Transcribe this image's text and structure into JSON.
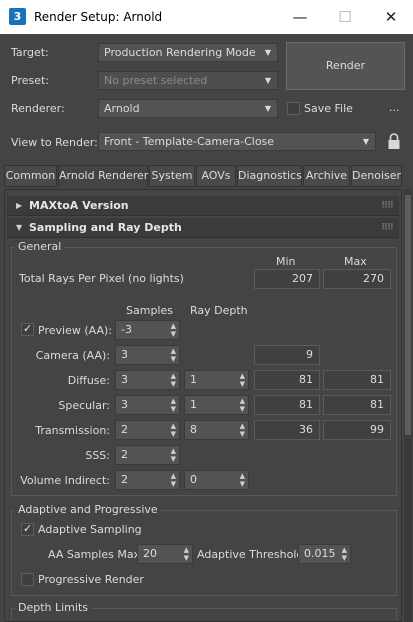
{
  "window": {
    "app_icon_text": "3",
    "title": "Render Setup: Arnold",
    "minimize": "—",
    "maximize": "☐",
    "close": "✕"
  },
  "target": {
    "label": "Target:",
    "value": "Production Rendering Mode"
  },
  "preset": {
    "label": "Preset:",
    "value": "No preset selected"
  },
  "renderer": {
    "label": "Renderer:",
    "value": "Arnold"
  },
  "save_file": {
    "label": "Save File",
    "checked": false
  },
  "more_button": "...",
  "view_to_render": {
    "label": "View to Render:",
    "value": "Front - Template-Camera-Close"
  },
  "lock_icon": "lock-icon",
  "render_button": "Render",
  "tabs": [
    "Common",
    "Arnold Renderer",
    "System",
    "AOVs",
    "Diagnostics",
    "Archive",
    "Denoiser"
  ],
  "active_tab": "Arnold Renderer",
  "rollouts": {
    "maxtoa": {
      "title": "MAXtoA Version",
      "expanded": false
    },
    "sampling": {
      "title": "Sampling and Ray Depth",
      "expanded": true
    }
  },
  "general": {
    "title": "General",
    "min_header": "Min",
    "max_header": "Max",
    "total_rays_label": "Total Rays Per Pixel (no lights)",
    "total_rays_min": "207",
    "total_rays_max": "270",
    "samples_header": "Samples",
    "ray_depth_header": "Ray Depth",
    "rows": [
      {
        "label": "Preview (AA):",
        "samples": "-3",
        "checkbox": true,
        "checked": true
      },
      {
        "label": "Camera (AA):",
        "samples": "3",
        "min": "9"
      },
      {
        "label": "Diffuse:",
        "samples": "3",
        "depth": "1",
        "min": "81",
        "max": "81"
      },
      {
        "label": "Specular:",
        "samples": "3",
        "depth": "1",
        "min": "81",
        "max": "81"
      },
      {
        "label": "Transmission:",
        "samples": "2",
        "depth": "8",
        "min": "36",
        "max": "99"
      },
      {
        "label": "SSS:",
        "samples": "2"
      },
      {
        "label": "Volume Indirect:",
        "samples": "2",
        "depth": "0"
      }
    ]
  },
  "adaptive": {
    "title": "Adaptive and Progressive",
    "adaptive_sampling_label": "Adaptive Sampling",
    "adaptive_sampling_checked": true,
    "aa_samples_max_label": "AA Samples Max:",
    "aa_samples_max": "20",
    "adaptive_threshold_label": "Adaptive Threshold:",
    "adaptive_threshold": "0.015",
    "progressive_label": "Progressive Render",
    "progressive_checked": false
  },
  "depth_limits": {
    "title": "Depth Limits"
  }
}
